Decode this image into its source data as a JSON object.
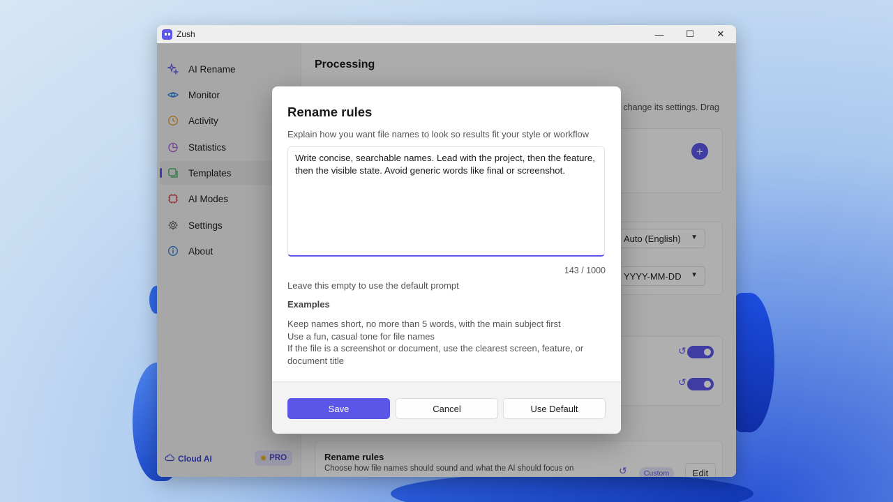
{
  "app": {
    "title": "Zush"
  },
  "window_controls": {
    "minimize": "—",
    "maximize": "☐",
    "close": "✕"
  },
  "sidebar": {
    "items": [
      {
        "label": "AI Rename",
        "icon": "sparkle-icon",
        "color": "#5b56e8"
      },
      {
        "label": "Monitor",
        "icon": "eye-icon",
        "color": "#2b7bd8"
      },
      {
        "label": "Activity",
        "icon": "history-icon",
        "color": "#e09b2d"
      },
      {
        "label": "Statistics",
        "icon": "pie-chart-icon",
        "color": "#a85bd8"
      },
      {
        "label": "Templates",
        "icon": "template-icon",
        "color": "#2fae5b"
      },
      {
        "label": "AI Modes",
        "icon": "chip-icon",
        "color": "#d83b3b"
      },
      {
        "label": "Settings",
        "icon": "gear-icon",
        "color": "#666666"
      },
      {
        "label": "About",
        "icon": "info-icon",
        "color": "#2b7bd8"
      }
    ],
    "active": "Templates",
    "cloud_label": "Cloud AI",
    "pro_label": "PRO"
  },
  "content": {
    "page_title": "Processing",
    "partial_text": "o change its settings. Drag",
    "language_select": "Auto (English)",
    "date_select": "YYYY-MM-DD",
    "rename_rules_title": "Rename rules",
    "rename_rules_desc": "Choose how file names should sound and what the AI should focus on",
    "custom_badge": "Custom",
    "edit_label": "Edit"
  },
  "dialog": {
    "title": "Rename rules",
    "subtitle": "Explain how you want file names to look so results fit your style or workflow",
    "text_value": "Write concise, searchable names. Lead with the project, then the feature, then the visible state. Avoid generic words like final or screenshot.",
    "counter": "143 / 1000",
    "hint": "Leave this empty to use the default prompt",
    "examples_title": "Examples",
    "examples": [
      "Keep names short, no more than 5 words, with the main subject first",
      "Use a fun, casual tone for file names",
      "If the file is a screenshot or document, use the clearest screen, feature, or document title"
    ],
    "save_label": "Save",
    "cancel_label": "Cancel",
    "default_label": "Use Default"
  },
  "colors": {
    "accent": "#5b56e8"
  }
}
